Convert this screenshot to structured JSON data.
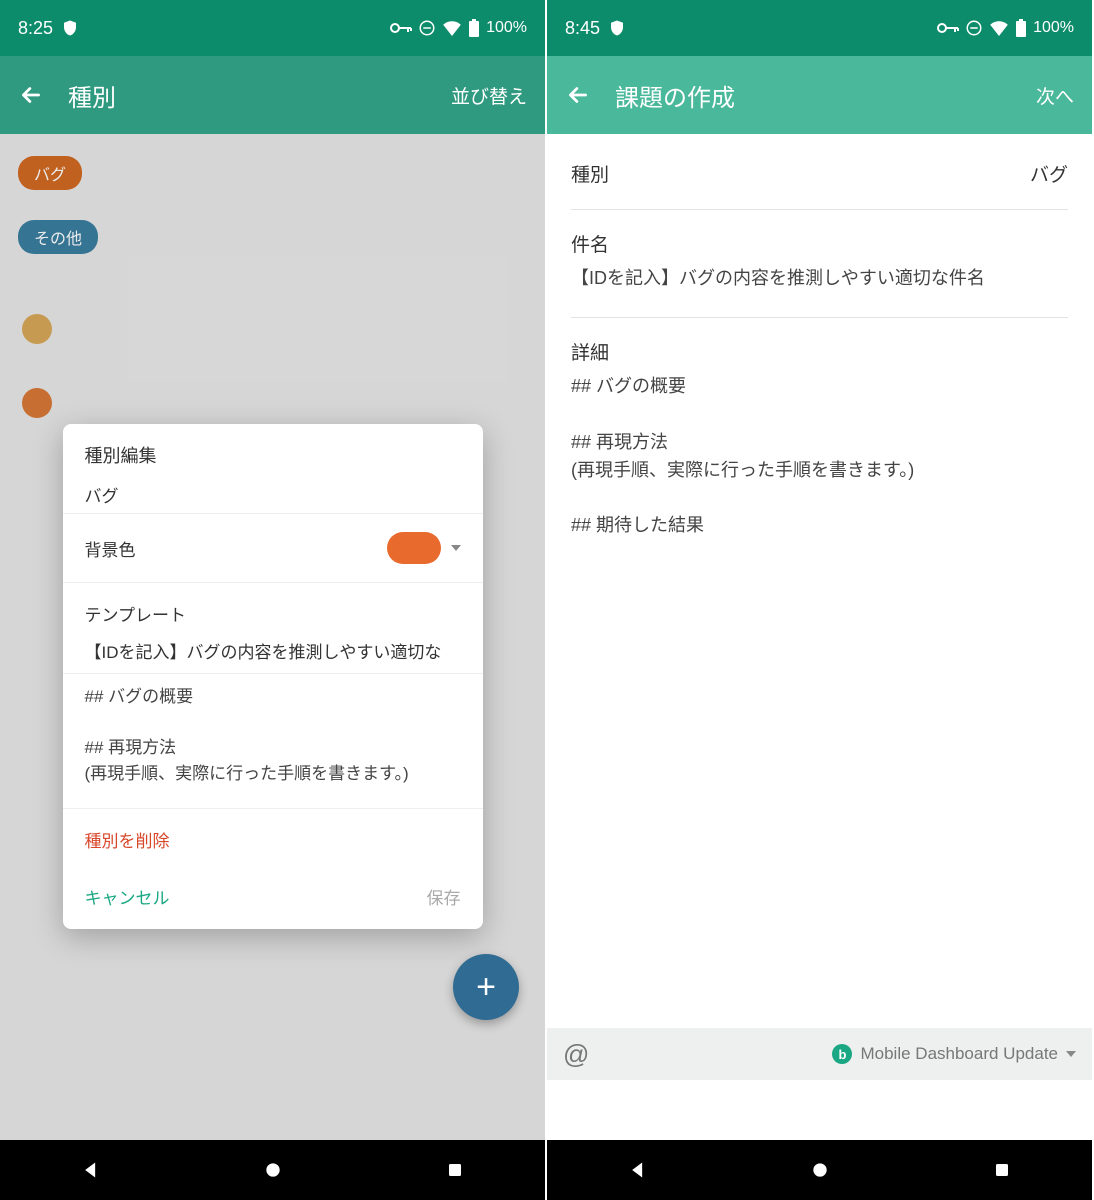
{
  "left": {
    "status": {
      "time": "8:25",
      "battery": "100%"
    },
    "appbar": {
      "title": "種別",
      "action": "並び替え"
    },
    "chips": {
      "bug": "バグ",
      "other": "その他"
    },
    "dialog": {
      "title": "種別編集",
      "name_value": "バグ",
      "bg_label": "背景色",
      "template_label": "テンプレート",
      "template_subject": "【IDを記入】バグの内容を推測しやすい適切な",
      "template_body": "## バグの概要\n\n## 再現方法\n(再現手順、実際に行った手順を書きます。)",
      "delete": "種別を削除",
      "cancel": "キャンセル",
      "save": "保存"
    }
  },
  "right": {
    "status": {
      "time": "8:45",
      "battery": "100%"
    },
    "appbar": {
      "title": "課題の作成",
      "action": "次へ"
    },
    "form": {
      "type_label": "種別",
      "type_value": "バグ",
      "subject_label": "件名",
      "subject_value": "【IDを記入】バグの内容を推測しやすい適切な件名",
      "detail_label": "詳細",
      "detail_value": "## バグの概要\n\n## 再現方法\n(再現手順、実際に行った手順を書きます。)\n\n## 期待した結果"
    },
    "toolbar": {
      "mention": "@",
      "project": "Mobile Dashboard Update",
      "badge": "b"
    }
  },
  "colors": {
    "status_bg": "#0d8c6b",
    "appbar_left": "#2f9a7f",
    "appbar_right": "#4ab89b",
    "chip_bug": "#d26a22",
    "chip_other": "#3b7ea0",
    "swatch": "#e86a2d",
    "fab": "#2f6b93",
    "accent": "#1aa783",
    "delete": "#d9472b"
  }
}
